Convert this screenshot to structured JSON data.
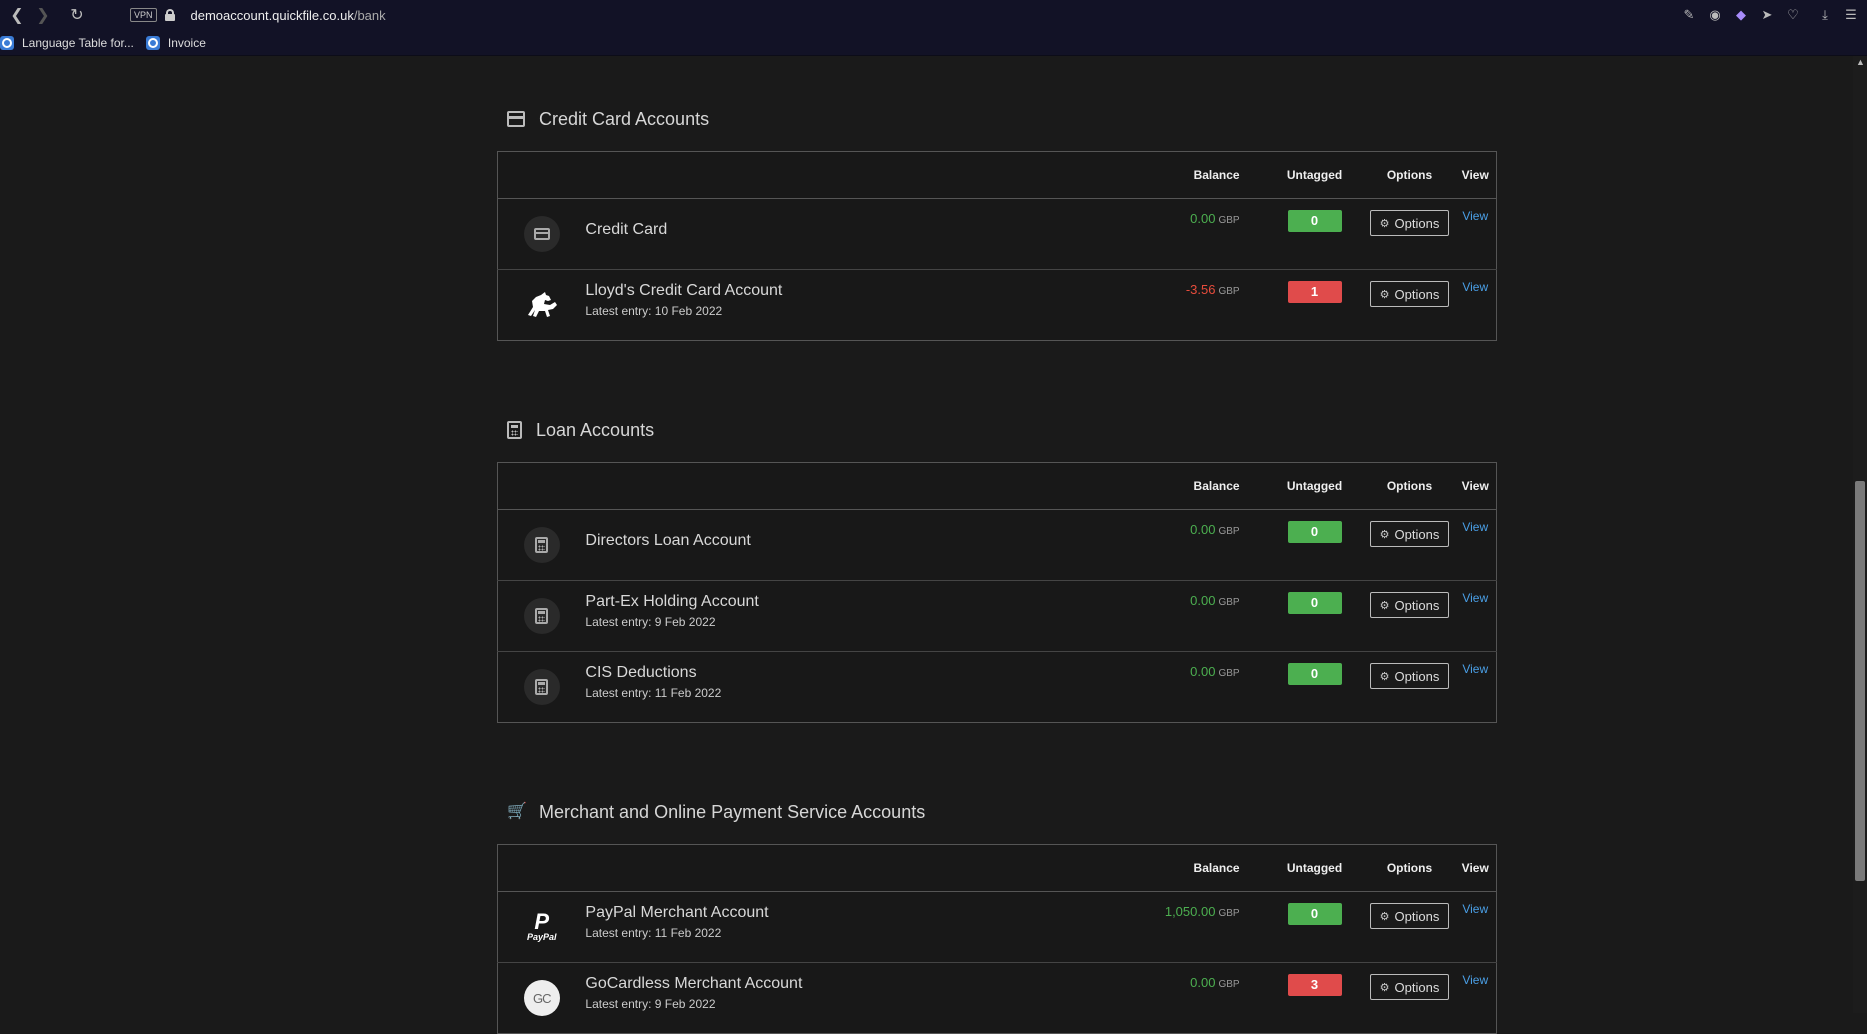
{
  "browser": {
    "vpn_label": "VPN",
    "url_host": "demoaccount.quickfile.co.uk",
    "url_path": "/bank",
    "bookmarks": [
      {
        "label": "Language Table for..."
      },
      {
        "label": "Invoice"
      }
    ]
  },
  "table_headers": {
    "balance": "Balance",
    "untagged": "Untagged",
    "options": "Options",
    "view": "View"
  },
  "sections": [
    {
      "title": "Credit Card Accounts",
      "icon": "credit-card-icon",
      "rows": [
        {
          "name": "Credit Card",
          "sub": "",
          "icon": "credit-card-icon",
          "balance": "0.00",
          "currency": "GBP",
          "untagged": "0",
          "untagged_status": "green",
          "options_label": "Options",
          "view_label": "View"
        },
        {
          "name": "Lloyd's Credit Card Account",
          "sub": "Latest entry: 10 Feb 2022",
          "icon": "lloyds-horse-icon",
          "balance": "-3.56",
          "currency": "GBP",
          "untagged": "1",
          "untagged_status": "red",
          "options_label": "Options",
          "view_label": "View"
        }
      ]
    },
    {
      "title": "Loan Accounts",
      "icon": "calculator-icon",
      "rows": [
        {
          "name": "Directors Loan Account",
          "sub": "",
          "icon": "calculator-icon",
          "balance": "0.00",
          "currency": "GBP",
          "untagged": "0",
          "untagged_status": "green",
          "options_label": "Options",
          "view_label": "View"
        },
        {
          "name": "Part-Ex Holding Account",
          "sub": "Latest entry: 9 Feb 2022",
          "icon": "calculator-icon",
          "balance": "0.00",
          "currency": "GBP",
          "untagged": "0",
          "untagged_status": "green",
          "options_label": "Options",
          "view_label": "View"
        },
        {
          "name": "CIS Deductions",
          "sub": "Latest entry: 11 Feb 2022",
          "icon": "calculator-icon",
          "balance": "0.00",
          "currency": "GBP",
          "untagged": "0",
          "untagged_status": "green",
          "options_label": "Options",
          "view_label": "View"
        }
      ]
    },
    {
      "title": "Merchant and Online Payment Service Accounts",
      "icon": "shopping-cart-icon",
      "rows": [
        {
          "name": "PayPal Merchant Account",
          "sub": "Latest entry: 11 Feb 2022",
          "icon": "paypal-icon",
          "logo_text": "PayPal",
          "balance": "1,050.00",
          "currency": "GBP",
          "untagged": "0",
          "untagged_status": "green",
          "options_label": "Options",
          "view_label": "View"
        },
        {
          "name": "GoCardless Merchant Account",
          "sub": "Latest entry: 9 Feb 2022",
          "icon": "gocardless-icon",
          "logo_text": "GC",
          "balance": "0.00",
          "currency": "GBP",
          "untagged": "3",
          "untagged_status": "red",
          "options_label": "Options",
          "view_label": "View"
        }
      ]
    }
  ],
  "colors": {
    "positive": "#4caf50",
    "negative": "#e74c3c",
    "link": "#4a9fe6",
    "badge_green": "#4caf50",
    "badge_red": "#e04b4b"
  }
}
